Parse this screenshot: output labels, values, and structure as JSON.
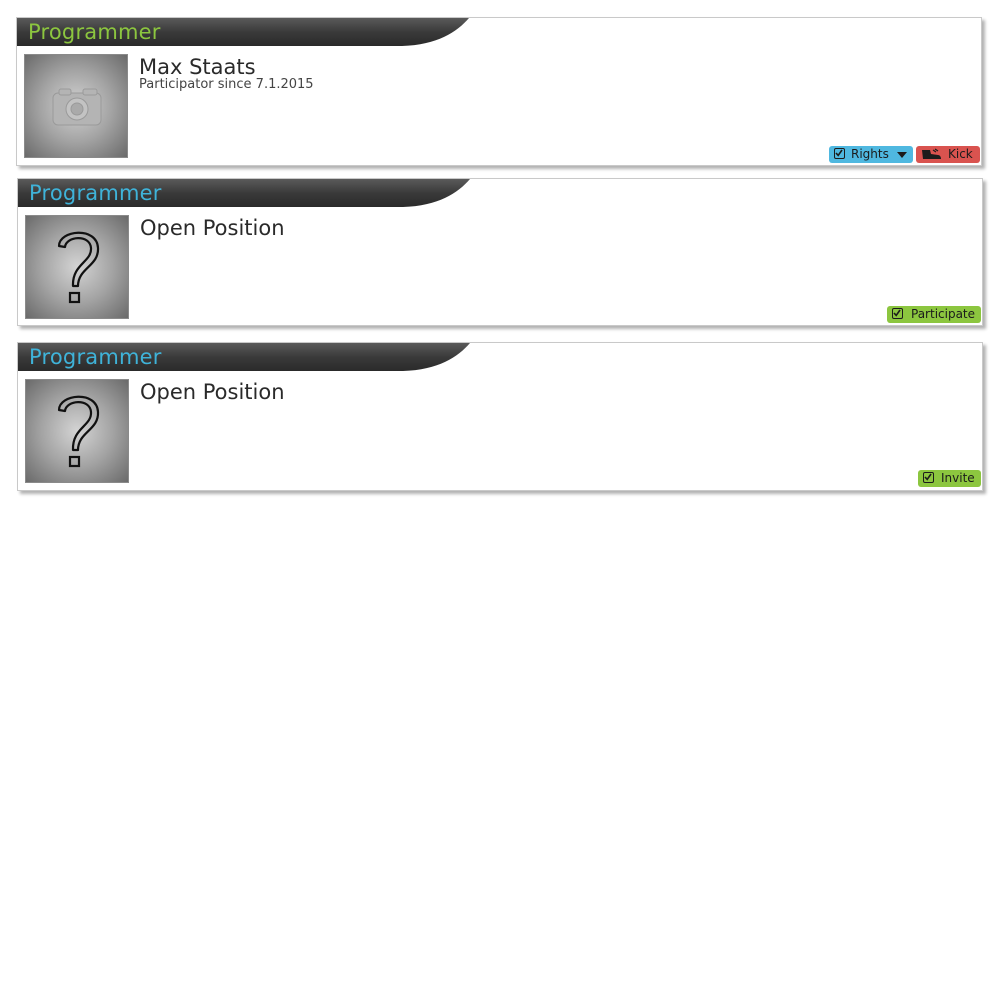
{
  "colors": {
    "role_active": "#8cc63f",
    "role_open": "#3fb3d9",
    "header_dark": "#3c3c3c",
    "rights_button": "#4fb8e0",
    "kick_button": "#d9534f",
    "green_button": "#8cc63f"
  },
  "cards": [
    {
      "role": "Programmer",
      "name": "Max Staats",
      "since": "Participator since 7.1.2015",
      "photo_icon": "camera-icon",
      "buttons": {
        "rights": "Rights",
        "kick": "Kick"
      }
    },
    {
      "role": "Programmer",
      "name": "Open Position",
      "photo_icon": "question-mark-icon",
      "buttons": {
        "participate": "Participate"
      }
    },
    {
      "role": "Programmer",
      "name": "Open Position",
      "photo_icon": "question-mark-icon",
      "buttons": {
        "invite": "Invite"
      }
    }
  ]
}
